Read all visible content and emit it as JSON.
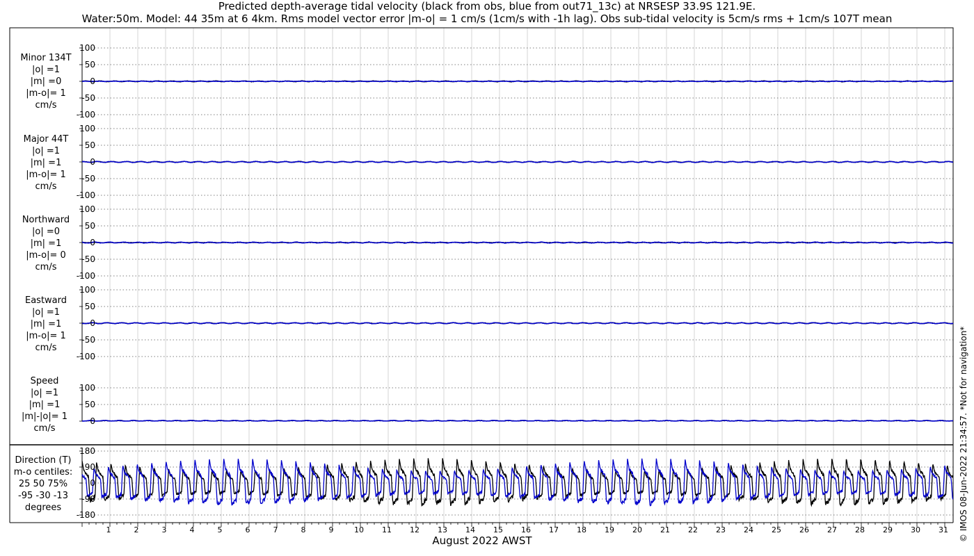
{
  "title_line1": "Predicted depth-average tidal velocity (black from obs, blue from out71_13c) at NRSESP 33.9S 121.9E.",
  "title_line2": "Water:50m. Model: 44 35m at 6 4km. Rms model vector error |m-o| = 1 cm/s (1cm/s with -1h lag). Obs sub-tidal velocity is 5cm/s rms + 1cm/s 107T mean",
  "copyright": "© IMOS 08-Jun-2022 21:34:57. *Not for navigation*",
  "colors": {
    "obs": "#000000",
    "model": "#0000cc"
  },
  "panels": [
    {
      "id": "minor",
      "label": [
        "Minor 134T",
        "|o| =1",
        "|m| =0",
        "|m-o|= 1",
        "cm/s"
      ],
      "yticks": [
        "100",
        "50",
        "0",
        "-50",
        "-100"
      ]
    },
    {
      "id": "major",
      "label": [
        "Major 44T",
        "|o| =1",
        "|m| =1",
        "|m-o|= 1",
        "cm/s"
      ],
      "yticks": [
        "100",
        "50",
        "0",
        "-50",
        "-100"
      ]
    },
    {
      "id": "north",
      "label": [
        "Northward",
        "|o| =0",
        "|m| =1",
        "|m-o|= 0",
        "cm/s"
      ],
      "yticks": [
        "100",
        "50",
        "0",
        "-50",
        "-100"
      ]
    },
    {
      "id": "east",
      "label": [
        "Eastward",
        "|o| =1",
        "|m| =1",
        "|m-o|= 1",
        "cm/s"
      ],
      "yticks": [
        "100",
        "50",
        "0",
        "-50",
        "-100"
      ]
    },
    {
      "id": "speed",
      "label": [
        "Speed",
        "|o| =1",
        "|m| =1",
        "|m|-|o|= 1",
        "cm/s"
      ],
      "yticks": [
        "100",
        "50",
        "0"
      ]
    },
    {
      "id": "direction",
      "label": [
        "Direction (T)",
        "m-o centiles:",
        "25  50  75%",
        "-95 -30 -13",
        "degrees"
      ],
      "yticks": [
        "180",
        "90",
        "0",
        "-90",
        "-180"
      ]
    }
  ],
  "chart_data": {
    "type": "line",
    "xlabel": "August 2022 AWST",
    "xticks": [
      "1",
      "2",
      "3",
      "4",
      "5",
      "6",
      "7",
      "8",
      "9",
      "10",
      "11",
      "12",
      "13",
      "14",
      "15",
      "16",
      "17",
      "18",
      "19",
      "20",
      "21",
      "22",
      "23",
      "24",
      "25",
      "26",
      "27",
      "28",
      "29",
      "30",
      "31"
    ],
    "xlim": [
      0,
      31.3
    ],
    "panels": [
      {
        "name": "Minor 134T",
        "ylim": [
          -100,
          100
        ],
        "obs_amplitude": 1,
        "model_amplitude": 0
      },
      {
        "name": "Major 44T",
        "ylim": [
          -100,
          100
        ],
        "obs_amplitude": 1,
        "model_amplitude": 1
      },
      {
        "name": "Northward",
        "ylim": [
          -100,
          100
        ],
        "obs_amplitude": 0,
        "model_amplitude": 1
      },
      {
        "name": "Eastward",
        "ylim": [
          -100,
          100
        ],
        "obs_amplitude": 1,
        "model_amplitude": 1
      },
      {
        "name": "Speed",
        "ylim": [
          0,
          100
        ],
        "obs_amplitude": 1,
        "model_amplitude": 1
      },
      {
        "name": "Direction (T)",
        "ylim": [
          -180,
          180
        ],
        "tidal_cycles_per_day": 1.93
      }
    ]
  }
}
